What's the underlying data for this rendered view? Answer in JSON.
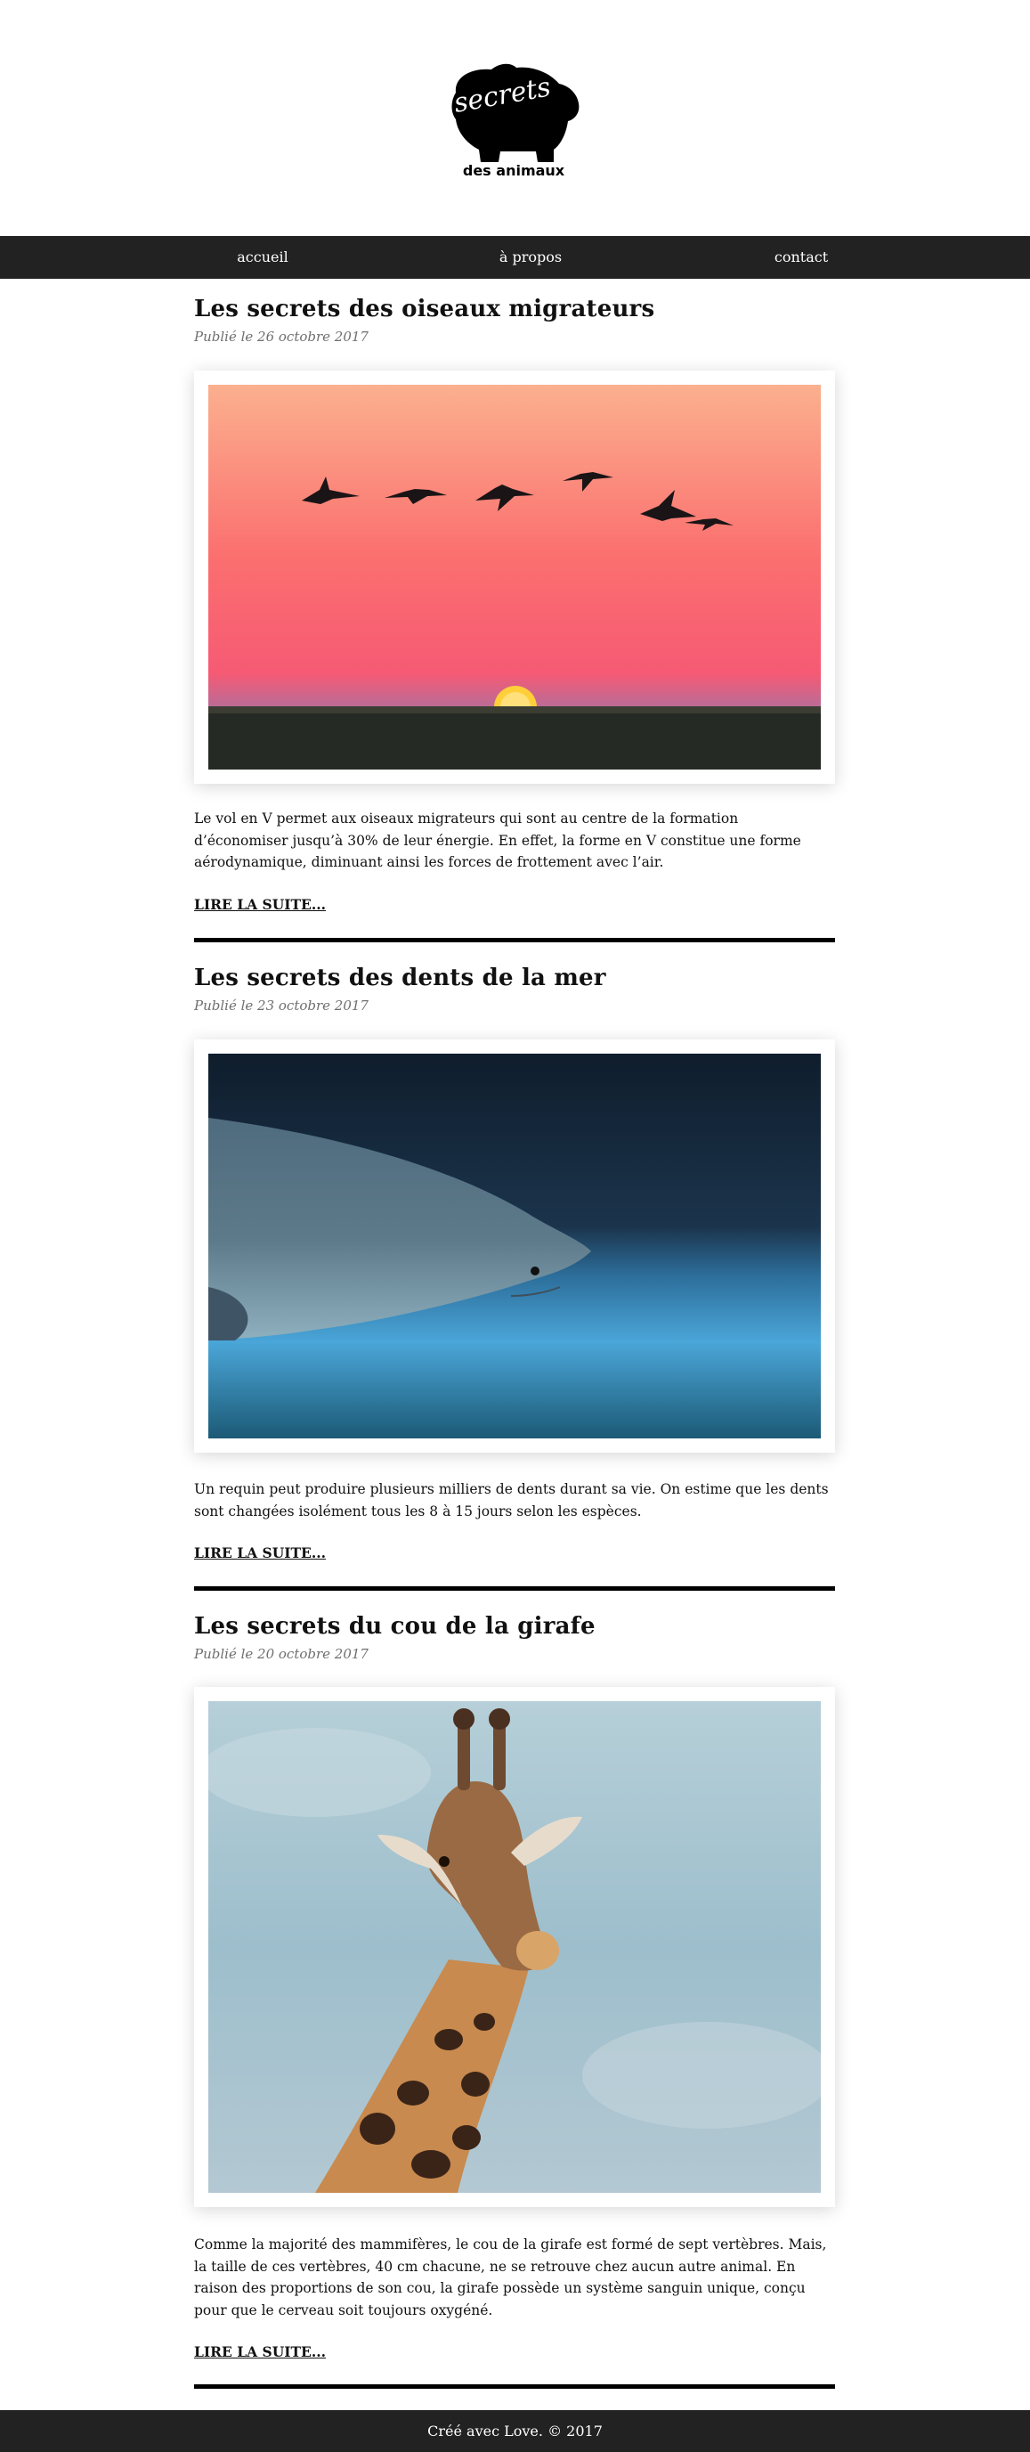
{
  "header": {
    "logo_text_main": "secrets",
    "logo_text_sub": "des animaux"
  },
  "nav": {
    "items": [
      {
        "label": "accueil"
      },
      {
        "label": "à propos"
      },
      {
        "label": "contact"
      }
    ]
  },
  "posts": [
    {
      "title": "Les secrets des oiseaux migrateurs",
      "date": "Publié le 26 octobre 2017",
      "image": "birds-sunset-photo",
      "excerpt": "Le vol en V permet aux oiseaux migrateurs qui sont au centre de la formation d’économiser jusqu’à 30% de leur énergie. En effet, la forme en V constitue une forme aérodynamique, diminuant ainsi les forces de frottement avec l’air.",
      "read_more": "LIRE LA SUITE..."
    },
    {
      "title": "Les secrets des dents de la mer",
      "date": "Publié le 23 octobre 2017",
      "image": "shark-photo",
      "excerpt": "Un requin peut produire plusieurs milliers de dents durant sa vie. On estime que les dents sont changées isolément tous les 8 à 15 jours selon les espèces.",
      "read_more": "LIRE LA SUITE..."
    },
    {
      "title": "Les secrets du cou de la girafe",
      "date": "Publié le 20 octobre 2017",
      "image": "giraffe-photo",
      "excerpt": "Comme la majorité des mammifères, le cou de la girafe est formé de sept vertèbres. Mais, la taille de ces vertèbres, 40 cm chacune, ne se retrouve chez aucun autre animal. En raison des proportions de son cou, la girafe possède un système sanguin unique, conçu pour que le cerveau soit toujours oxygéné.",
      "read_more": "LIRE LA SUITE..."
    }
  ],
  "footer": {
    "text": "Créé avec Love. © 2017"
  },
  "colors": {
    "nav_bg": "#222222",
    "separator": "#000000",
    "date_text": "#6f6f6f"
  }
}
